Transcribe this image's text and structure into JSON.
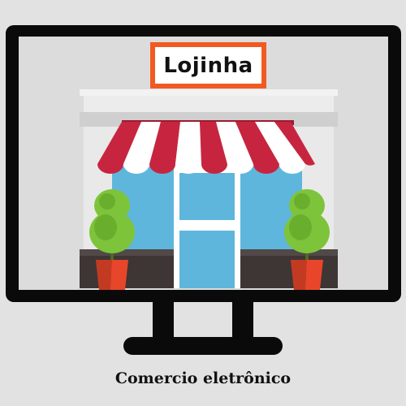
{
  "sign": {
    "text": "Lojinha"
  },
  "caption": {
    "text": "Comercio eletrônico"
  },
  "icons": {
    "monitor": "monitor-icon",
    "storefront": "storefront-icon",
    "awning": "awning-icon",
    "plant": "potted-plant-icon"
  },
  "colors": {
    "background": "#e2e2e2",
    "monitor_frame": "#0a0a0a",
    "sign_border": "#f05a22",
    "awning_red": "#c7253f",
    "awning_white": "#ffffff",
    "window_blue": "#5fb6dc",
    "wall": "#e9e9e9",
    "base": "#3e3535",
    "pot": "#e8462a",
    "plant": "#7ec43b"
  }
}
